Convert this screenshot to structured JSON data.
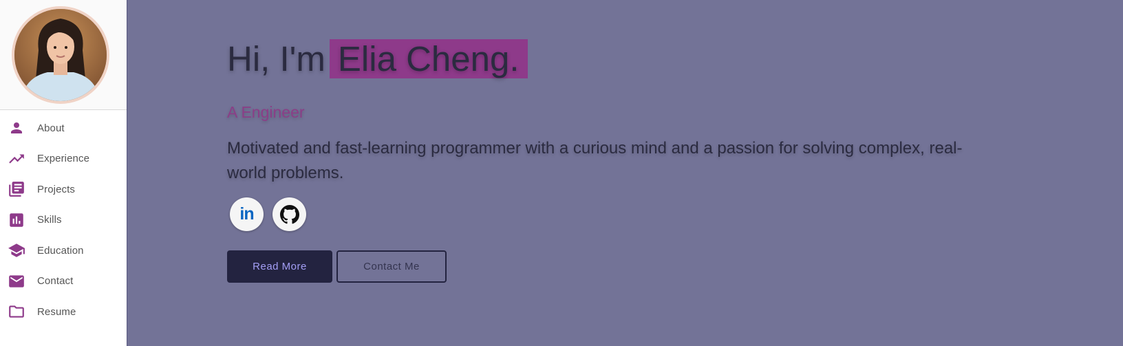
{
  "sidebar": {
    "items": [
      {
        "label": "About",
        "icon": "person-icon"
      },
      {
        "label": "Experience",
        "icon": "trending-up-icon"
      },
      {
        "label": "Projects",
        "icon": "library-books-icon"
      },
      {
        "label": "Skills",
        "icon": "bar-chart-icon"
      },
      {
        "label": "Education",
        "icon": "graduation-cap-icon"
      },
      {
        "label": "Contact",
        "icon": "mail-icon"
      },
      {
        "label": "Resume",
        "icon": "folder-icon"
      }
    ]
  },
  "hero": {
    "greeting": "Hi, I'm",
    "name": "Elia Cheng.",
    "subtitle": "A Engineer",
    "description": "Motivated and fast-learning programmer with a curious mind and a passion for solving complex, real-world problems."
  },
  "social": [
    "linkedin-icon",
    "github-icon"
  ],
  "buttons": {
    "read_more": "Read More",
    "contact_me": "Contact Me"
  },
  "colors": {
    "accent": "#8e3a8a",
    "background": "#737397",
    "dark": "#232340"
  }
}
